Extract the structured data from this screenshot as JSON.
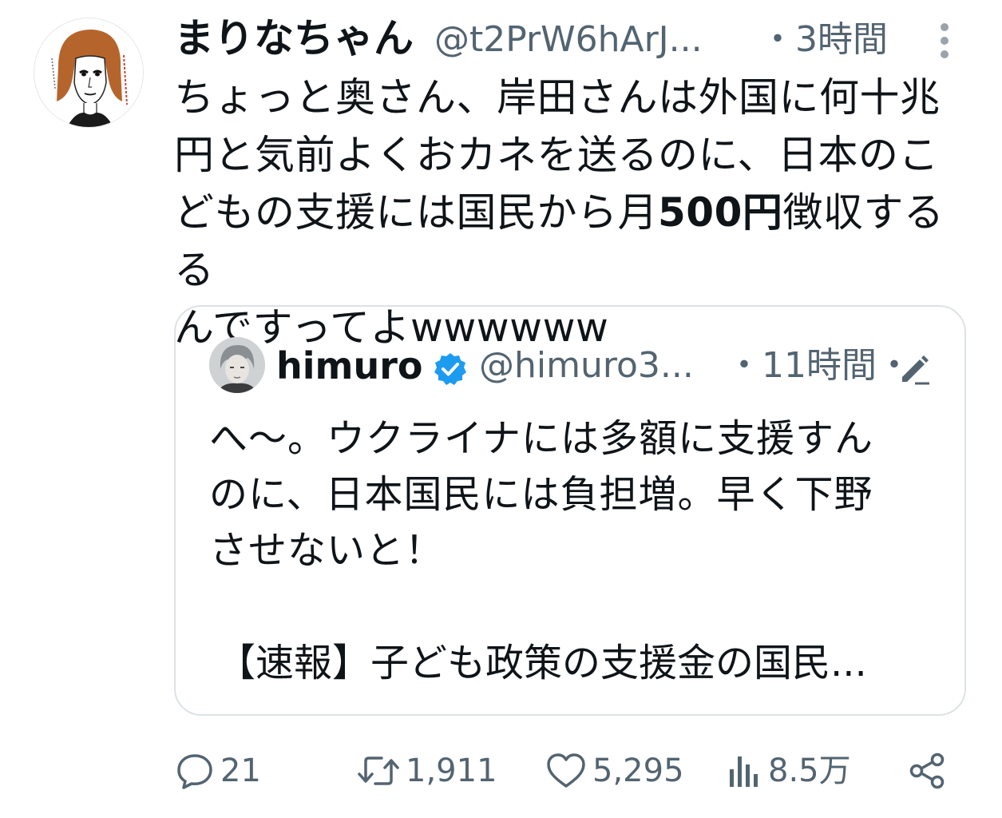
{
  "tweet": {
    "author": {
      "display_name": "まりなちゃん",
      "handle": "@t2PrW6hArJ...",
      "time": "・3時間"
    },
    "text_line1": "ちょっと奥さん、岸田さんは外国に何十兆",
    "text_line2": "円と気前よくおカネを送るのに、日本のこ",
    "text_line3_pre": "どもの支援には国民から月",
    "text_line3_bold": "500円",
    "text_line3_post": "徴収するる",
    "text_line4": "んですってよwwwwww"
  },
  "quote": {
    "display_name": "himuro",
    "handle": "@himuro3...",
    "time": "・11時間・",
    "text_line1": "へ～。ウクライナには多額に支援すん",
    "text_line2": "のに、日本国民には負担増。早く下野",
    "text_line3": "させないと！",
    "headline": "【速報】子ども政策の支援金の国民..."
  },
  "actions": {
    "replies": "21",
    "retweets": "1,911",
    "likes": "5,295",
    "views": "8.5万"
  },
  "icons": {
    "more": "more-vertical-icon",
    "verified": "verified-badge-icon",
    "edit": "edit-pencil-icon",
    "reply": "reply-icon",
    "retweet": "retweet-icon",
    "like": "heart-icon",
    "views": "views-bar-chart-icon",
    "share": "share-icon"
  },
  "colors": {
    "text_primary": "#0f1419",
    "text_secondary": "#536471",
    "verified_blue": "#1d9bf0",
    "card_border": "#dde2e6"
  }
}
